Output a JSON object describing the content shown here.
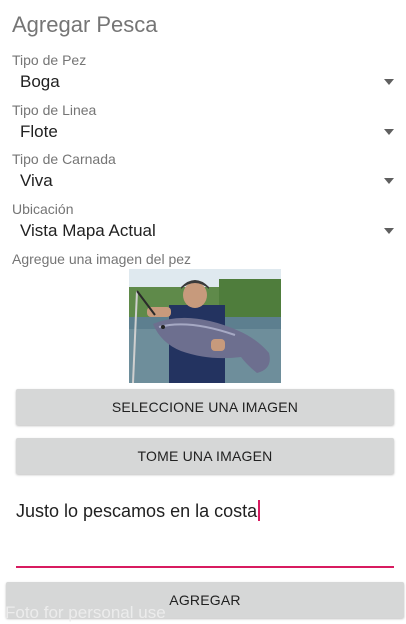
{
  "screen": {
    "title": "Agregar Pesca"
  },
  "fields": [
    {
      "label": "Tipo de Pez",
      "value": "Boga"
    },
    {
      "label": "Tipo de Linea",
      "value": "Flote"
    },
    {
      "label": "Tipo de Carnada",
      "value": "Viva"
    },
    {
      "label": "Ubicación",
      "value": "Vista Mapa Actual"
    }
  ],
  "image_section": {
    "label": "Agregue una imagen del pez"
  },
  "buttons": {
    "select_image": "SELECCIONE UNA IMAGEN",
    "take_image": "TOME UNA IMAGEN",
    "add": "AGREGAR"
  },
  "comment": {
    "value": "Justo lo pescamos en la costa"
  },
  "watermark": {
    "text": "Foto for personal use"
  },
  "colors": {
    "accent": "#d81b60",
    "button_bg": "#d6d7d7",
    "label": "#757575"
  }
}
